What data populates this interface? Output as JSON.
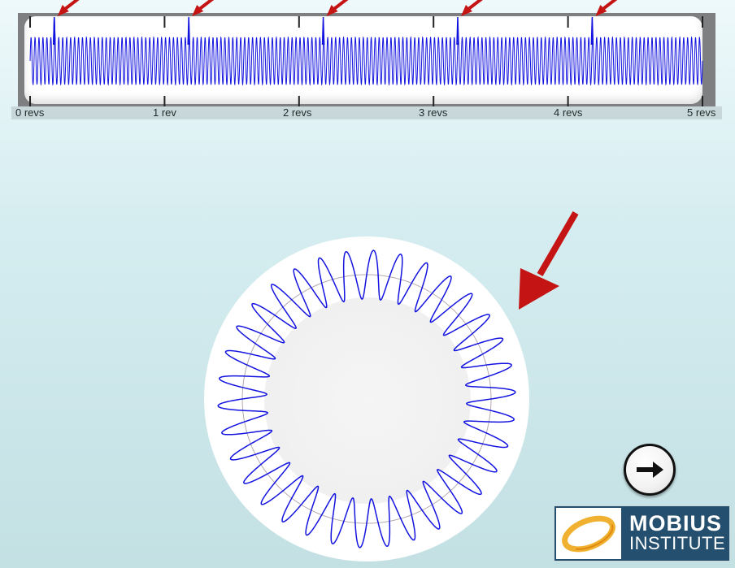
{
  "timeline": {
    "axis_labels": [
      "0 revs",
      "1 rev",
      "2 revs",
      "3 revs",
      "4 revs",
      "5 revs"
    ],
    "revolutions": 5,
    "cycles_per_rev": 34,
    "impact_positions_revs": [
      0.18,
      1.18,
      2.18,
      3.18,
      4.18
    ],
    "trace_color": "#1414e0",
    "arrow_color": "#c41414"
  },
  "polar_plot": {
    "cycles": 34,
    "trace_color": "#1414e0",
    "arrow_color": "#c41414"
  },
  "navigation": {
    "next_icon": "right-arrow-icon"
  },
  "logo": {
    "line1": "MOBIUS",
    "line2": "INSTITUTE",
    "background": "#244f6e",
    "emblem_color": "#f0b030"
  }
}
